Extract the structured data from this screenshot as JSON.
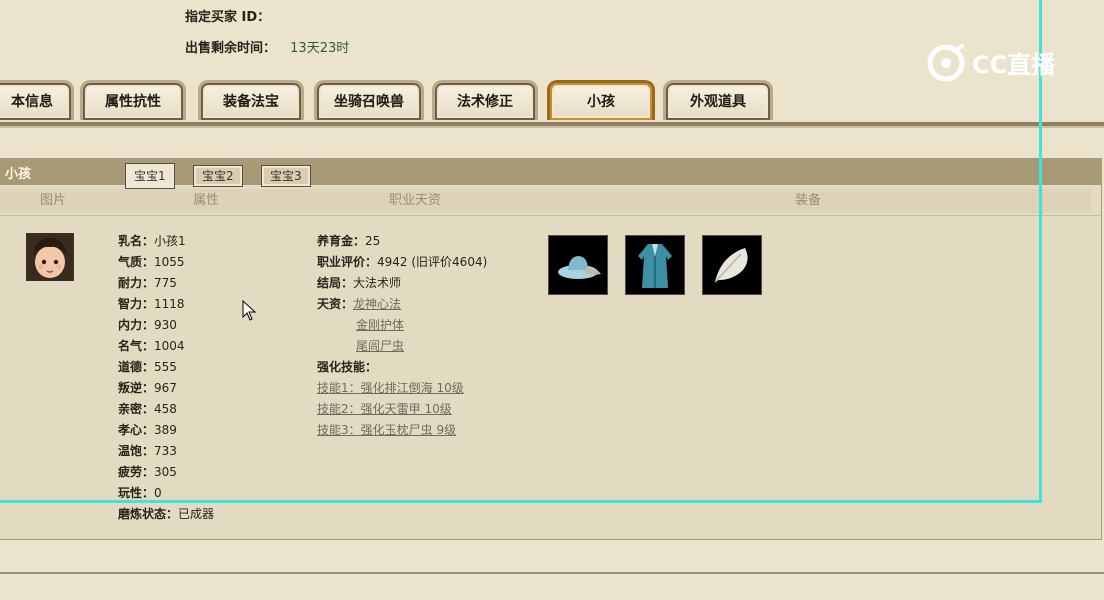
{
  "header": {
    "buyer_label": "指定买家 ID：",
    "time_label": "出售剩余时间：",
    "time_value": "13天23时"
  },
  "tabs": [
    "本信息",
    "属性抗性",
    "装备法宝",
    "坐骑召唤兽",
    "法术修正",
    "小孩",
    "外观道具"
  ],
  "active_tab": "小孩",
  "panel": {
    "title": "小孩",
    "subtabs": [
      "宝宝1",
      "宝宝2",
      "宝宝3"
    ],
    "columns": [
      "图片",
      "属性",
      "职业天资",
      "装备"
    ]
  },
  "attributes": [
    {
      "k": "乳名：",
      "v": "小孩1"
    },
    {
      "k": "气质：",
      "v": "1055"
    },
    {
      "k": "耐力：",
      "v": "775"
    },
    {
      "k": "智力：",
      "v": "1118"
    },
    {
      "k": "内力：",
      "v": "930"
    },
    {
      "k": "名气：",
      "v": "1004"
    },
    {
      "k": "道德：",
      "v": "555"
    },
    {
      "k": "叛逆：",
      "v": "967"
    },
    {
      "k": "亲密：",
      "v": "458"
    },
    {
      "k": "孝心：",
      "v": "389"
    },
    {
      "k": "温饱：",
      "v": "733"
    },
    {
      "k": "疲劳：",
      "v": "305"
    },
    {
      "k": "玩性：",
      "v": "0"
    },
    {
      "k": "磨炼状态：",
      "v": "已成器"
    }
  ],
  "career": {
    "fund_label": "养育金：",
    "fund_value": "25",
    "eval_label": "职业评价：",
    "eval_value": "4942 (旧评价4604)",
    "ending_label": "结局：",
    "ending_value": "大法术师",
    "talent_label": "天资：",
    "talents": [
      "龙神心法",
      "金刚护体",
      "尾闾尸虫"
    ],
    "skills_label": "强化技能：",
    "skills": [
      "技能1：强化排江倒海 10级",
      "技能2：强化天雷甲 10级",
      "技能3：强化玉枕尸虫 9级"
    ]
  },
  "equipment": [
    "hat-icon",
    "robe-icon",
    "feather-icon"
  ],
  "logo": {
    "text": "CC直播"
  },
  "colors": {
    "accent_frame": "#3ee3de",
    "panel_head": "#a99a77"
  }
}
